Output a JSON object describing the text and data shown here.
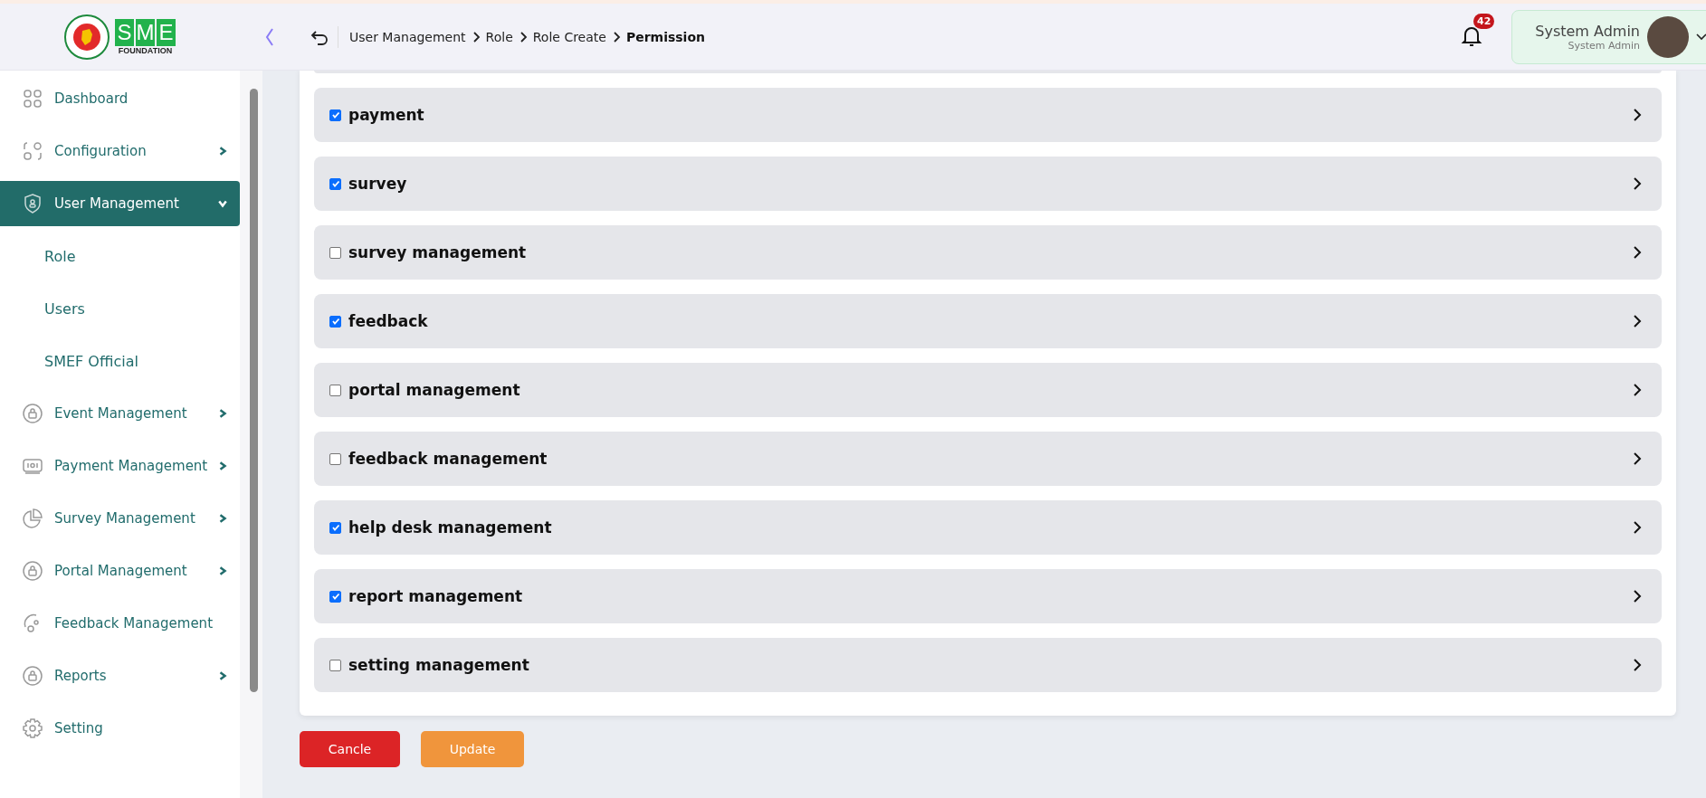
{
  "header": {
    "logo_text": "FOUNDATION",
    "logo_letters": [
      "S",
      "M",
      "E"
    ],
    "breadcrumb": [
      {
        "label": "User Management",
        "current": false
      },
      {
        "label": "Role",
        "current": false
      },
      {
        "label": "Role Create",
        "current": false
      },
      {
        "label": "Permission",
        "current": true
      }
    ],
    "notifications": "42",
    "user": {
      "name": "System Admin",
      "role": "System Admin"
    }
  },
  "sidebar": {
    "items": [
      {
        "label": "Dashboard",
        "selected": false
      },
      {
        "label": "Configuration",
        "expanded": false,
        "selected": false
      },
      {
        "label": "User Management",
        "expanded": true,
        "selected": true,
        "children": [
          {
            "label": "Role"
          },
          {
            "label": "Users"
          },
          {
            "label": "SMEF Official"
          }
        ]
      },
      {
        "label": "Event Management",
        "expanded": false,
        "selected": false
      },
      {
        "label": "Payment Management",
        "expanded": false,
        "selected": false
      },
      {
        "label": "Survey Management",
        "expanded": false,
        "selected": false
      },
      {
        "label": "Portal Management",
        "expanded": false,
        "selected": false
      },
      {
        "label": "Feedback Management",
        "selected": false
      },
      {
        "label": "Reports",
        "expanded": false,
        "selected": false
      },
      {
        "label": "Setting",
        "selected": false
      }
    ]
  },
  "permissions": [
    {
      "label": "payment",
      "checked": true
    },
    {
      "label": "survey",
      "checked": true
    },
    {
      "label": "survey management",
      "checked": false
    },
    {
      "label": "feedback",
      "checked": true
    },
    {
      "label": "portal management",
      "checked": false
    },
    {
      "label": "feedback management",
      "checked": false
    },
    {
      "label": "help desk management",
      "checked": true
    },
    {
      "label": "report management",
      "checked": true
    },
    {
      "label": "setting management",
      "checked": false
    }
  ],
  "buttons": [
    {
      "label": "Cancle",
      "kind": "danger"
    },
    {
      "label": "Update",
      "kind": "warning"
    }
  ]
}
